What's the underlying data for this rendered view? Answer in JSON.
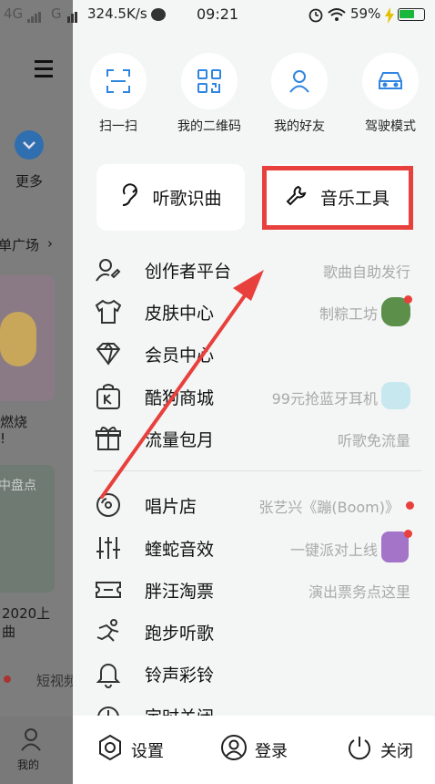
{
  "status_bar": {
    "signal_left": "4G",
    "signal_right": "G",
    "speed": "324.5K/s",
    "time": "09:21",
    "battery": "59%"
  },
  "background": {
    "more_label": "更多",
    "square_label": "单广场",
    "card1_line1": "燃烧",
    "card1_line2": "!",
    "card2_top": "中盘点",
    "card2_line1": "2020上",
    "card2_line2": "曲",
    "shortvideo_label": "短视频",
    "mine_label": "我的"
  },
  "quick_actions": [
    {
      "label": "扫一扫",
      "icon": "scan-icon"
    },
    {
      "label": "我的二维码",
      "icon": "qrcode-icon"
    },
    {
      "label": "我的好友",
      "icon": "friend-icon"
    },
    {
      "label": "驾驶模式",
      "icon": "car-icon"
    }
  ],
  "big_buttons": {
    "recognize": "听歌识曲",
    "music_tools": "音乐工具"
  },
  "menu": [
    {
      "label": "创作者平台",
      "hint": "歌曲自助发行",
      "icon": "creator-icon"
    },
    {
      "label": "皮肤中心",
      "hint": "制粽工坊",
      "icon": "shirt-icon"
    },
    {
      "label": "会员中心",
      "hint": "",
      "icon": "diamond-icon"
    },
    {
      "label": "酷狗商城",
      "hint": "99元抢蓝牙耳机",
      "icon": "shop-icon"
    },
    {
      "label": "流量包月",
      "hint": "听歌免流量",
      "icon": "gift-icon"
    },
    {
      "label": "唱片店",
      "hint": "张艺兴《蹦(Boom)》",
      "icon": "disc-icon"
    },
    {
      "label": "蝰蛇音效",
      "hint": "一键派对上线",
      "icon": "equalizer-icon"
    },
    {
      "label": "胖汪淘票",
      "hint": "演出票务点这里",
      "icon": "ticket-icon"
    },
    {
      "label": "跑步听歌",
      "hint": "",
      "icon": "running-icon"
    },
    {
      "label": "铃声彩铃",
      "hint": "",
      "icon": "bell-icon"
    },
    {
      "label": "定时关闭",
      "hint": "",
      "icon": "timer-icon"
    }
  ],
  "bottom_bar": {
    "settings": "设置",
    "login": "登录",
    "close": "关闭"
  },
  "colors": {
    "accent_red": "#e8403c",
    "drawer_bg": "#f4f5f5",
    "blue": "#2f86e0"
  }
}
